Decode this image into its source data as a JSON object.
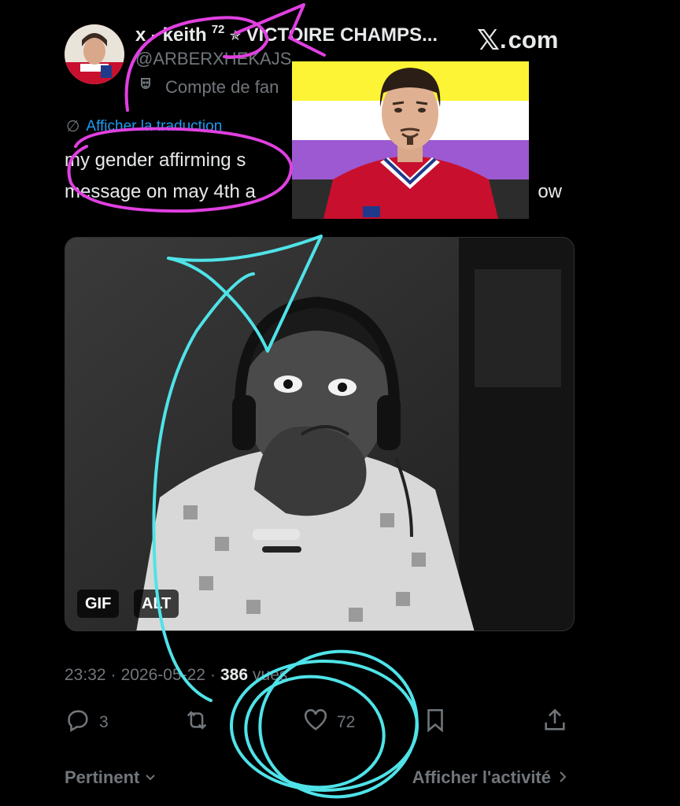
{
  "header": {
    "display_name": "x - keith",
    "superscript": "72",
    "star": "✯",
    "name_suffix": "VICTOIRE CHAMPS...",
    "handle": "@ARBERXHEKAJS",
    "account_label": "Compte de fan",
    "site_logo": "com"
  },
  "translate_label": "Afficher la traduction",
  "tweet": {
    "line1": "my gender affirming s",
    "line2_left": "message on may 4th a",
    "line2_right": "ow"
  },
  "media": {
    "badge_gif": "GIF",
    "badge_alt": "ALT"
  },
  "meta": {
    "time": "23:32",
    "date": "2026-05-22",
    "views_count": "386",
    "views_label": "vues"
  },
  "actions": {
    "reply_count": "3",
    "like_count": "72"
  },
  "footer": {
    "sort_label": "Pertinent",
    "activity_label": "Afficher l'activité"
  },
  "colors": {
    "background": "#000000",
    "text": "#e7e9ea",
    "muted": "#71767b",
    "link": "#1d9bf0",
    "annotation_magenta": "#e040e0",
    "annotation_cyan": "#4fe3e8",
    "flag_yellow": "#fcf434",
    "flag_white": "#ffffff",
    "flag_purple": "#9c59d1",
    "flag_black": "#2c2c2c"
  }
}
